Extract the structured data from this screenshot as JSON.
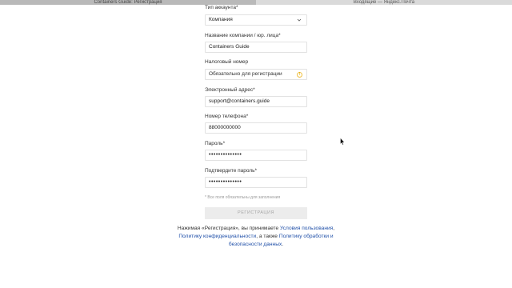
{
  "browser": {
    "tabs": [
      {
        "title": "Containers Guide: Регистрация",
        "active": true
      },
      {
        "title": "Входящие — Яндекс.Почта",
        "active": false
      }
    ]
  },
  "form": {
    "account_type": {
      "label": "Тип аккаунта",
      "required": "*",
      "value": "Компания"
    },
    "company_name": {
      "label": "Название компании / юр. лица",
      "required": "*",
      "value": "Containers Guide"
    },
    "tax_number": {
      "label": "Налоговый номер",
      "placeholder": "Обязательно для регистрации"
    },
    "email": {
      "label": "Электронный адрес",
      "required": "*",
      "value": "support@containers.guide"
    },
    "phone": {
      "label": "Номер телефона",
      "required": "*",
      "value": "88000000000"
    },
    "password": {
      "label": "Пароль",
      "required": "*",
      "value": "••••••••••••••"
    },
    "password_confirm": {
      "label": "Подтвердите пароль",
      "required": "*",
      "value": "••••••••••••••"
    },
    "required_note": "* Все поля обязательны для заполнения",
    "submit_label": "РЕГИСТРАЦИЯ"
  },
  "terms": {
    "prefix": "Нажимая «Регистрация», вы принимаете",
    "link_terms": "Условия пользования",
    "sep": ",",
    "link_privacy": "Политику конфиденциальности",
    "middle": ", а также",
    "link_processing": "Политику обработки и безопасности данных",
    "end": "."
  },
  "colors": {
    "link": "#1f4fa8",
    "warning": "#e0a800",
    "disabled_button": "#ececec"
  }
}
